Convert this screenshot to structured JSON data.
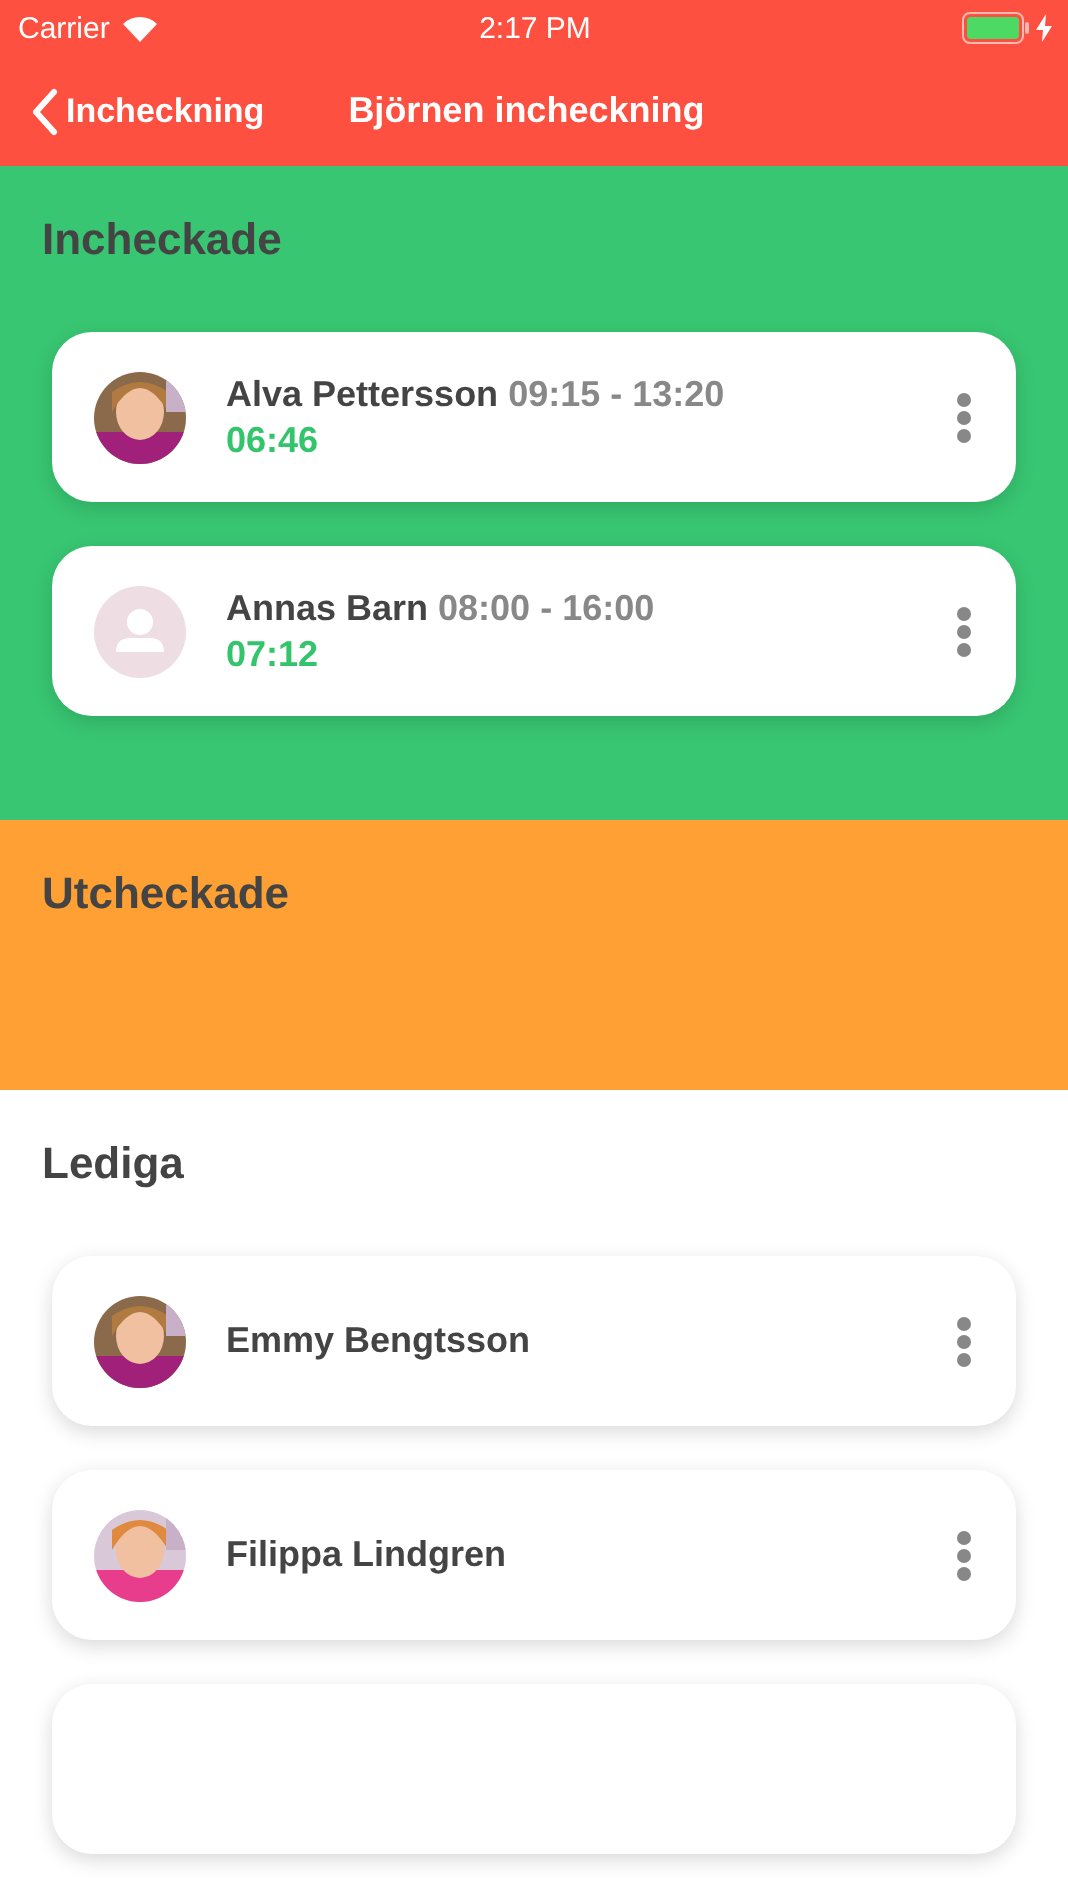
{
  "status_bar": {
    "carrier": "Carrier",
    "time": "2:17 PM",
    "charging": true
  },
  "nav": {
    "back": "Incheckning",
    "title": "Björnen incheckning"
  },
  "sections": [
    {
      "kind": "checked_in",
      "title": "Incheckade",
      "people": [
        {
          "name": "Alva Pettersson",
          "hours": "09:15 - 13:20",
          "elapsed": "06:46"
        },
        {
          "name": "Annas Barn",
          "hours": "08:00 - 16:00",
          "elapsed": "07:12",
          "kind": "placeholder"
        }
      ]
    },
    {
      "kind": "checked_out",
      "title": "Utcheckade"
    },
    {
      "kind": "free",
      "title": "Lediga",
      "people": [
        {
          "name": "Emmy Bengtsson"
        },
        {
          "name": "Filippa Lindgren"
        },
        {
          "kind": "hidden"
        }
      ]
    }
  ]
}
